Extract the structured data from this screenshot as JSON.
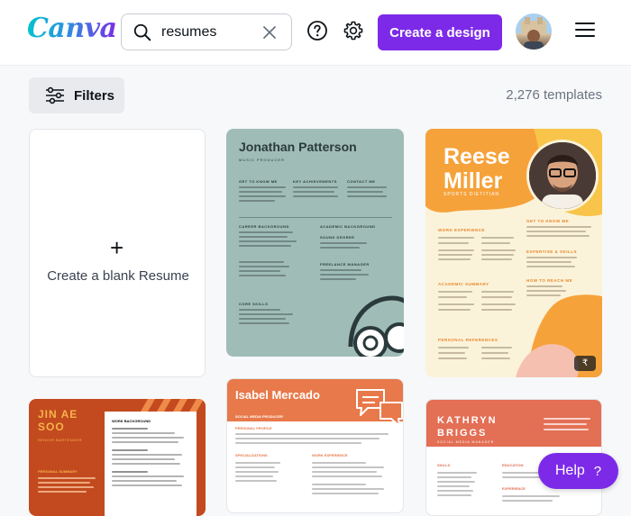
{
  "header": {
    "logo": "Canva",
    "search": {
      "value": "resumes",
      "placeholder": ""
    },
    "create_button_label": "Create a design",
    "icons": [
      "search-icon",
      "close-icon",
      "help-icon",
      "gear-icon",
      "menu-icon"
    ]
  },
  "toolbar": {
    "filters_label": "Filters",
    "template_count": "2,276 templates"
  },
  "blank_card": {
    "plus": "+",
    "label": "Create a blank Resume"
  },
  "templates": [
    {
      "name": "Jonathan Patterson",
      "subtitle": "MUSIC PRODUCER",
      "sections": [
        "GET TO KNOW ME",
        "KEY ACHIEVEMENTS",
        "CONTACT ME",
        "CAREER BACKGROUND",
        "ACADEMIC BACKGROUND",
        "SOUND DEGREE",
        "FREELANCE MANAGER",
        "CORE SKILLS"
      ],
      "background": "#9fbdb6"
    },
    {
      "name_line1": "Reese",
      "name_line2": "Miller",
      "subtitle": "SPORTS DIETITIAN",
      "sections": [
        "GET TO KNOW ME",
        "WORK EXPERIENCE",
        "EXPERTISE & SKILLS",
        "ACADEMIC SUMMARY",
        "HOW TO REACH ME",
        "PERSONAL REFERENCES"
      ],
      "badge": "₹",
      "background": "#fbf3d9"
    },
    {
      "name_line1": "JIN AE",
      "name_line2": "SOO",
      "subtitle": "SENIOR BARTENDER",
      "sections": [
        "WORK BACKGROUND",
        "PERSONAL SUMMARY"
      ],
      "background": "#c24a1e"
    },
    {
      "name": "Isabel Mercado",
      "subtitle": "SOCIAL MEDIA PRODUCER",
      "sections": [
        "PERSONAL PROFILE",
        "SPECIALIZATIONS",
        "WORK EXPERIENCE"
      ],
      "background": "#e8794a"
    },
    {
      "name_line1": "KATHRYN",
      "name_line2": "BRIGGS",
      "subtitle": "SOCIAL MEDIA MANAGER",
      "sections": [
        "SKILLS",
        "EDUCATION",
        "EXPERIENCE"
      ],
      "background": "#e36f55"
    }
  ],
  "help": {
    "label": "Help",
    "icon_text": "?"
  },
  "colors": {
    "brand": "#7d2ae8"
  }
}
